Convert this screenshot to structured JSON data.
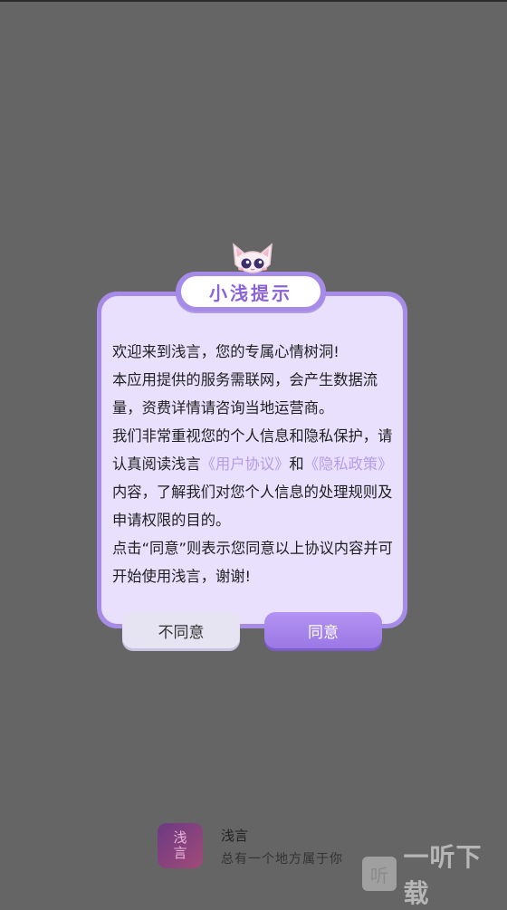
{
  "dialog": {
    "title": "小浅提示",
    "intro_1": "欢迎来到浅言，您的专属心情树洞!",
    "intro_2": "本应用提供的服务需联网，会产生数据流量，资费详情请咨询当地运营商。",
    "intro_3a": "我们非常重视您的个人信息和隐私保护，请认真阅读浅言",
    "user_agreement": "《用户协议》",
    "conj": "和",
    "privacy_policy": "《隐私政策》",
    "intro_3b": "内容，了解我们对您个人信息的处理规则及申请权限的目的。",
    "intro_4": "点击“同意”则表示您同意以上协议内容并可开始使用浅言，谢谢!",
    "decline_label": "不同意",
    "agree_label": "同意"
  },
  "footer": {
    "logo_text": "浅言",
    "app_name": "浅言",
    "slogan": "总有一个地方属于你"
  },
  "watermark": {
    "icon_char": "听",
    "text": "一听下载"
  },
  "colors": {
    "overlay": "#656565",
    "accent": "#a78be8",
    "card_bg": "#e8e0fc",
    "link": "#b59de8"
  }
}
